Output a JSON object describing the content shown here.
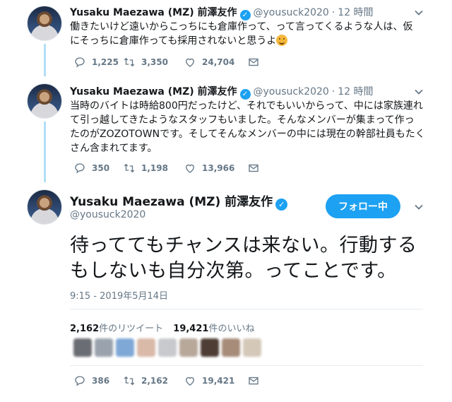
{
  "tweets": [
    {
      "name": "Yusaku Maezawa (MZ) 前澤友作",
      "handle": "@yousuck2020",
      "time": "12 時間",
      "body": [
        "働きたいけど遠いからこっちにも倉庫作って、って言ってくるような人は、仮",
        "にそっちに倉庫作っても採用されないと思うよ"
      ],
      "replies": "1,225",
      "retweets": "3,350",
      "likes": "24,704"
    },
    {
      "name": "Yusaku Maezawa (MZ) 前澤友作",
      "handle": "@yousuck2020",
      "time": "12 時間",
      "body": [
        "当時のバイトは時給800円だったけど、それでもいいからって、中には家族連れ",
        "て引っ越してきたようなスタッフもいました。そんなメンバーが集まって作っ",
        "たのがZOZOTOWNです。そしてそんなメンバーの中には現在の幹部社員もたく",
        "さん含まれてます。"
      ],
      "replies": "350",
      "retweets": "1,198",
      "likes": "13,966"
    }
  ],
  "main_tweet": {
    "name": "Yusaku Maezawa (MZ) 前澤友作",
    "handle": "@yousuck2020",
    "follow_label": "フォロー中",
    "text": [
      "待っててもチャンスは来ない。行動する",
      "もしないも自分次第。ってことです。"
    ],
    "timestamp": "9:15 - 2019年5月14日",
    "retweet_count": "2,162",
    "retweet_label": "件のリツイート",
    "like_count": "19,421",
    "like_label": "件のいいね",
    "replies": "386",
    "retweets": "2,162",
    "likes": "19,421"
  },
  "colors": {
    "accent": "#1da1f2",
    "secondary_text": "#657786",
    "thread_line": "#b0dff5"
  }
}
